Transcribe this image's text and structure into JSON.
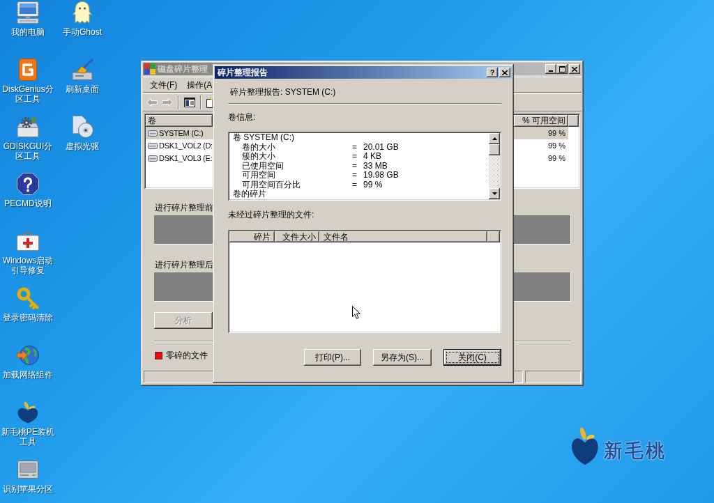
{
  "desktop": {
    "columns": [
      {
        "icons": [
          {
            "kind": "computer",
            "label": "我的电脑"
          },
          {
            "kind": "diskgenius",
            "label": "DiskGenius分区工具"
          },
          {
            "kind": "gdiskgui",
            "label": "GDISKGUI分区工具"
          },
          {
            "kind": "help",
            "label": "PECMD说明"
          },
          {
            "kind": "first_aid",
            "label": "Windows启动引导修复"
          },
          {
            "kind": "key",
            "label": "登录密码清除"
          },
          {
            "kind": "globe",
            "label": "加载网络组件"
          },
          {
            "kind": "peach",
            "label": "新毛桃PE装机工具"
          },
          {
            "kind": "drive",
            "label": "识别苹果分区"
          }
        ]
      },
      {
        "icons": [
          {
            "kind": "ghost",
            "label": "手动Ghost"
          },
          {
            "kind": "broom",
            "label": "刷新桌面"
          },
          {
            "kind": "disc",
            "label": "虚拟光驱"
          }
        ]
      }
    ]
  },
  "wallpaper": {
    "logo_text": "新毛桃"
  },
  "defrag_window": {
    "active": false,
    "title": "磁盘碎片整理",
    "menu": [
      "文件(F)",
      "操作(A"
    ],
    "toolbar": [
      {
        "kind": "back",
        "disabled": true
      },
      {
        "kind": "forward",
        "disabled": true
      },
      {
        "kind": "separator"
      },
      {
        "kind": "console_tree",
        "disabled": false
      },
      {
        "kind": "separator"
      },
      {
        "kind": "properties",
        "disabled": false
      }
    ],
    "volumes": {
      "columns": [
        "卷",
        "% 可用空间"
      ],
      "rows": [
        {
          "name": "SYSTEM (C:)",
          "free_space": "99 %",
          "selected": true
        },
        {
          "name": "DSK1_VOL2 (D:",
          "free_space": "99 %",
          "selected": false
        },
        {
          "name": "DSK1_VOL3 (E:",
          "free_space": "99 %",
          "selected": false
        }
      ]
    },
    "before_label": "进行碎片整理前",
    "after_label": "进行碎片整理后",
    "analyze_button": {
      "label": "分析",
      "disabled": true
    },
    "legend": [
      {
        "label": "零碎的文件",
        "color": "#ff0000"
      }
    ]
  },
  "report_dialog": {
    "active": true,
    "title": "碎片整理报告",
    "help_button": "?",
    "heading": "碎片整理报告: SYSTEM (C:)",
    "volume_info_label": "卷信息:",
    "volume_info": [
      {
        "kind": "heading",
        "text": "卷 SYSTEM (C:)"
      },
      {
        "kind": "field",
        "name": "卷的大小",
        "sign": "=",
        "value": "20.01 GB"
      },
      {
        "kind": "field",
        "name": "簇的大小",
        "sign": "=",
        "value": "4 KB"
      },
      {
        "kind": "field",
        "name": "已使用空间",
        "sign": "=",
        "value": "33 MB"
      },
      {
        "kind": "field",
        "name": "可用空间",
        "sign": "=",
        "value": "19.98 GB"
      },
      {
        "kind": "field",
        "name": "可用空间百分比",
        "sign": "=",
        "value": "99 %"
      },
      {
        "kind": "heading",
        "text": "卷的碎片"
      }
    ],
    "files_label": "未经过碎片整理的文件:",
    "files_table": {
      "columns": [
        "碎片",
        "文件大小",
        "文件名"
      ]
    },
    "buttons": [
      {
        "label": "打印(P)...",
        "focused": false
      },
      {
        "label": "另存为(S)...",
        "focused": false
      },
      {
        "label": "关闭(C)",
        "focused": true
      }
    ]
  }
}
